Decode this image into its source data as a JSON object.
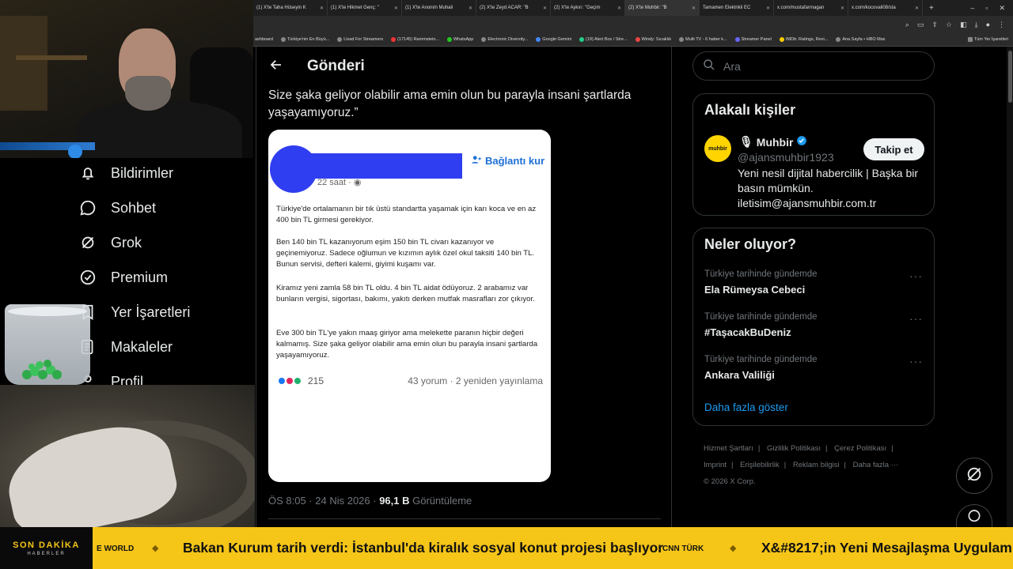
{
  "browser": {
    "tabs": [
      {
        "label": "(1) X'te Taha Hüseyin K",
        "active": false
      },
      {
        "label": "(1) X'te Hikmet Genç: \"",
        "active": false
      },
      {
        "label": "(1) X'te Anonim Muhali",
        "active": false
      },
      {
        "label": "(2) X'te Zeyd ACAR: \"B",
        "active": false
      },
      {
        "label": "(2) X'te Aykırı: \"Geçim",
        "active": false
      },
      {
        "label": "(2) X'te Muhbir: \"B",
        "active": true
      },
      {
        "label": "Tamamen Elektrikli EC",
        "active": false
      },
      {
        "label": "x.com/mustafarmagan",
        "active": false
      },
      {
        "label": "x.com/kocovali08/sta",
        "active": false
      }
    ],
    "bookmarks": [
      "ashboard",
      "Türkiye'nin En Büyü...",
      "Livad For Streamers",
      "(17145) Rammstein...",
      "WhatsApp",
      "Electronic Diversity...",
      "Google Gemini",
      "(19) Alert Box / Stre...",
      "Windy: Sıcaklık",
      "Multi TV - 6 haber k...",
      "Streamer Panel",
      "IMDb: Ratings, Revi...",
      "Ana Sayfa • HBO Max",
      "Tüm Yer İşaretleri"
    ]
  },
  "nav": {
    "items": [
      {
        "label": "Bildirimler",
        "icon": "bell-icon"
      },
      {
        "label": "Sohbet",
        "icon": "chat-icon"
      },
      {
        "label": "Grok",
        "icon": "grok-icon"
      },
      {
        "label": "Premium",
        "icon": "verified-icon"
      },
      {
        "label": "Yer İşaretleri",
        "icon": "bookmark-icon"
      },
      {
        "label": "Makaleler",
        "icon": "article-icon"
      },
      {
        "label": "Profil",
        "icon": "profile-icon"
      }
    ]
  },
  "post": {
    "header_title": "Gönderi",
    "text": "Size şaka geliyor olabilir ama emin olun bu parayla insani şartlarda yaşayamıyoruz.”",
    "meta_time": "ÖS 8:05 · 24 Nis 2026 · ",
    "meta_views": "96,1 B",
    "meta_views_label": " Görüntüleme",
    "card": {
      "connect_label": "Bağlantı kur",
      "time": "22 saat ·",
      "paragraphs": [
        "Türkiye'de ortalamanın bir tık üstü standartta yaşamak için karı koca ve en az 400 bin TL girmesi gerekiyor.",
        "Ben 140 bin TL kazanıyorum eşim 150 bin TL civarı kazanıyor ve geçinemiyoruz. Sadece oğlumun ve kızımın aylık özel okul taksiti 140 bin TL. Bunun servisi, defteri kalemi, giyimi kuşamı var.",
        "Kiramız yeni zamla 58 bin TL oldu. 4 bin TL aidat ödüyoruz. 2 arabamız var bunların vergisi, sigortası, bakımı, yakıtı derken mutfak masrafları zor çıkıyor.",
        "Eve 300 bin TL'ye yakın maaş giriyor ama melekette paranın hiçbir değeri kalmamış. Size şaka geliyor olabilir ama emin olun bu parayla insani şartlarda yaşayamıyoruz."
      ],
      "reactions_count": "215",
      "stats": "43 yorum · 2 yeniden yayınlama"
    }
  },
  "sidebar": {
    "search_placeholder": "Ara",
    "related": {
      "title": "Alakalı kişiler",
      "avatar_text": "muhbir",
      "name": "Muhbir",
      "handle": "@ajansmuhbir1923",
      "bio": "Yeni nesil dijital habercilik | Başka bir basın mümkün. iletisim@ajansmuhbir.com.tr",
      "follow_label": "Takip et"
    },
    "trends": {
      "title": "Neler oluyor?",
      "items": [
        {
          "context": "Türkiye tarihinde gündemde",
          "name": "Ela Rümeysa Cebeci"
        },
        {
          "context": "Türkiye tarihinde gündemde",
          "name": "#TaşacakBuDeniz"
        },
        {
          "context": "Türkiye tarihinde gündemde",
          "name": "Ankara Valiliği"
        }
      ],
      "show_more": "Daha fazla göster"
    },
    "footer": [
      "Hizmet Şartları",
      "|",
      "Gizlilik Politikası",
      "|",
      "Çerez Politikası",
      "|",
      "Imprint",
      "|",
      "Erişilebilirlik",
      "|",
      "Reklam bilgisi",
      "|",
      "Daha fazla ···",
      "© 2026 X Corp."
    ]
  },
  "ticker": {
    "badge_line1": "SON DAKİKA",
    "badge_line2": "HABERLER",
    "source1": "E WORLD",
    "headline1": "Bakan Kurum tarih verdi: İstanbul'da kiralık sosyal konut projesi başlıyor",
    "source2": "CNN TÜRK",
    "headline2": "X&#8217;in Yeni Mesajlaşma Uygulam"
  },
  "colors": {
    "accent": "#1d9bf0",
    "ticker": "#f5c518",
    "redaction": "#2f3ef0"
  }
}
